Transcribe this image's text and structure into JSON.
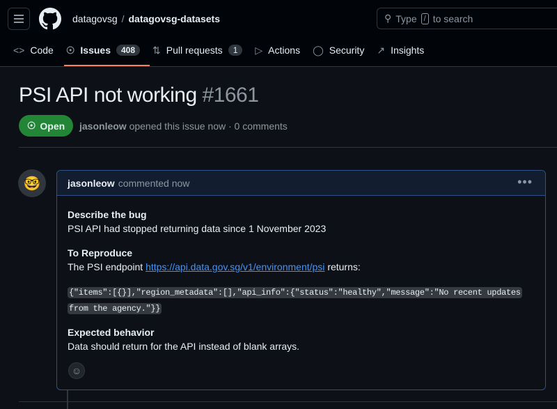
{
  "header": {
    "owner": "datagovsg",
    "separator": "/",
    "repo": "datagovsg-datasets",
    "search_prefix": "Type",
    "search_key": "/",
    "search_suffix": "to search"
  },
  "nav": {
    "tabs": [
      {
        "label": "Code"
      },
      {
        "label": "Issues",
        "count": "408"
      },
      {
        "label": "Pull requests",
        "count": "1"
      },
      {
        "label": "Actions"
      },
      {
        "label": "Security"
      },
      {
        "label": "Insights"
      }
    ]
  },
  "issue": {
    "title": "PSI API not working",
    "number": "#1661",
    "state": "Open",
    "author": "jasonleow",
    "meta": "opened this issue now · 0 comments"
  },
  "comment": {
    "author": "jasonleow",
    "time": "commented now",
    "h1": "Describe the bug",
    "p1": "PSI API had stopped returning data since 1 November 2023",
    "h2": "To Reproduce",
    "p2a": "The PSI endpoint",
    "link": "https://api.data.gov.sg/v1/environment/psi",
    "p2b": "returns:",
    "code_line1": "{\"items\":[{}],\"region_metadata\":[],\"api_info\":{\"status\":\"healthy\",\"message\":\"No recent updates",
    "code_line2": "from the agency.\"}}",
    "h3": "Expected behavior",
    "p3": "Data should return for the API instead of blank arrays."
  }
}
